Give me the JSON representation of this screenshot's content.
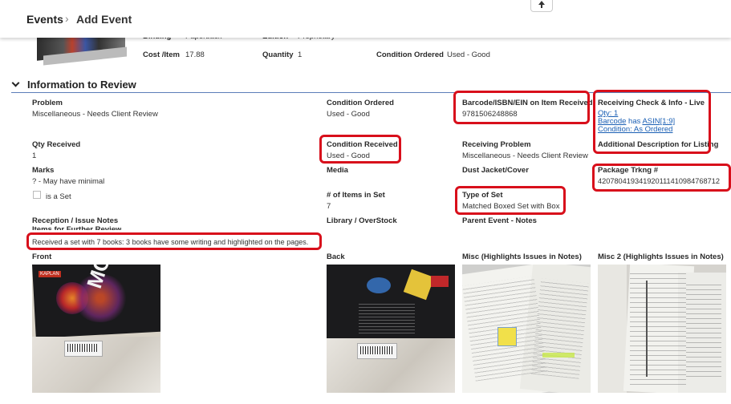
{
  "header": {
    "breadcrumb_root": "Events",
    "separator": "›",
    "current": "Add Event"
  },
  "top_row": {
    "binding_label": "Binding",
    "binding_value": "Paperback",
    "edition_label": "Edition",
    "edition_value": "Proprietary",
    "cost_label": "Cost /Item",
    "cost_value": "17.88",
    "quantity_label": "Quantity",
    "quantity_value": "1",
    "condition_ordered_label": "Condition Ordered",
    "condition_ordered_value": "Used - Good"
  },
  "section": {
    "title": "Information to Review",
    "chevron": "chevron-down-icon"
  },
  "fields": {
    "problem_label": "Problem",
    "problem_value": "Miscellaneous - Needs Client Review",
    "condition_ordered_label": "Condition Ordered",
    "condition_ordered_value": "Used - Good",
    "barcode_label": "Barcode/ISBN/EIN on Item Received",
    "barcode_value": "9781506248868",
    "receiving_check_label": "Receiving Check & Info - Live",
    "qty_link": "Qty: 1",
    "barcode_link": "Barcode",
    "barcode_link_suffix": " has ",
    "asin_link": "ASIN[1:9]",
    "condition_link": "Condition: As Ordered",
    "qty_received_label": "Qty Received",
    "qty_received_value": "1",
    "condition_received_label": "Condition Received",
    "condition_received_value": "Used - Good",
    "receiving_problem_label": "Receiving Problem",
    "receiving_problem_value": "Miscellaneous - Needs Client Review",
    "additional_desc_label": "Additional Description for Listing",
    "marks_label": "Marks",
    "marks_value": "? - May have minimal",
    "media_label": "Media",
    "dust_jacket_label": "Dust Jacket/Cover",
    "package_label": "Package Trkng #",
    "package_value": "420780419341920111410984768712",
    "is_set_label": "is a Set",
    "items_in_set_label": "# of Items in Set",
    "items_in_set_value": "7",
    "type_of_set_label": "Type of Set",
    "type_of_set_value": "Matched Boxed Set with Box",
    "reception_notes_label": "Reception / Issue Notes",
    "items_further_label": "Items for Further Review",
    "reception_notes_value": "Received a set with 7 books: 3 books have some writing and highlighted on the pages.",
    "library_label": "Library / OverStock",
    "parent_event_label": "Parent Event - Notes"
  },
  "photos": {
    "front_label": "Front",
    "back_label": "Back",
    "misc_label": "Misc (Highlights Issues in Notes)",
    "misc2_label": "Misc 2 (Highlights Issues in Notes)",
    "front_cover_text": "MCAT",
    "front_brand": "KAPLAN"
  },
  "colors": {
    "highlight": "#d80f1b",
    "link": "#1a5fb4",
    "section_rule": "#5b7db8"
  }
}
